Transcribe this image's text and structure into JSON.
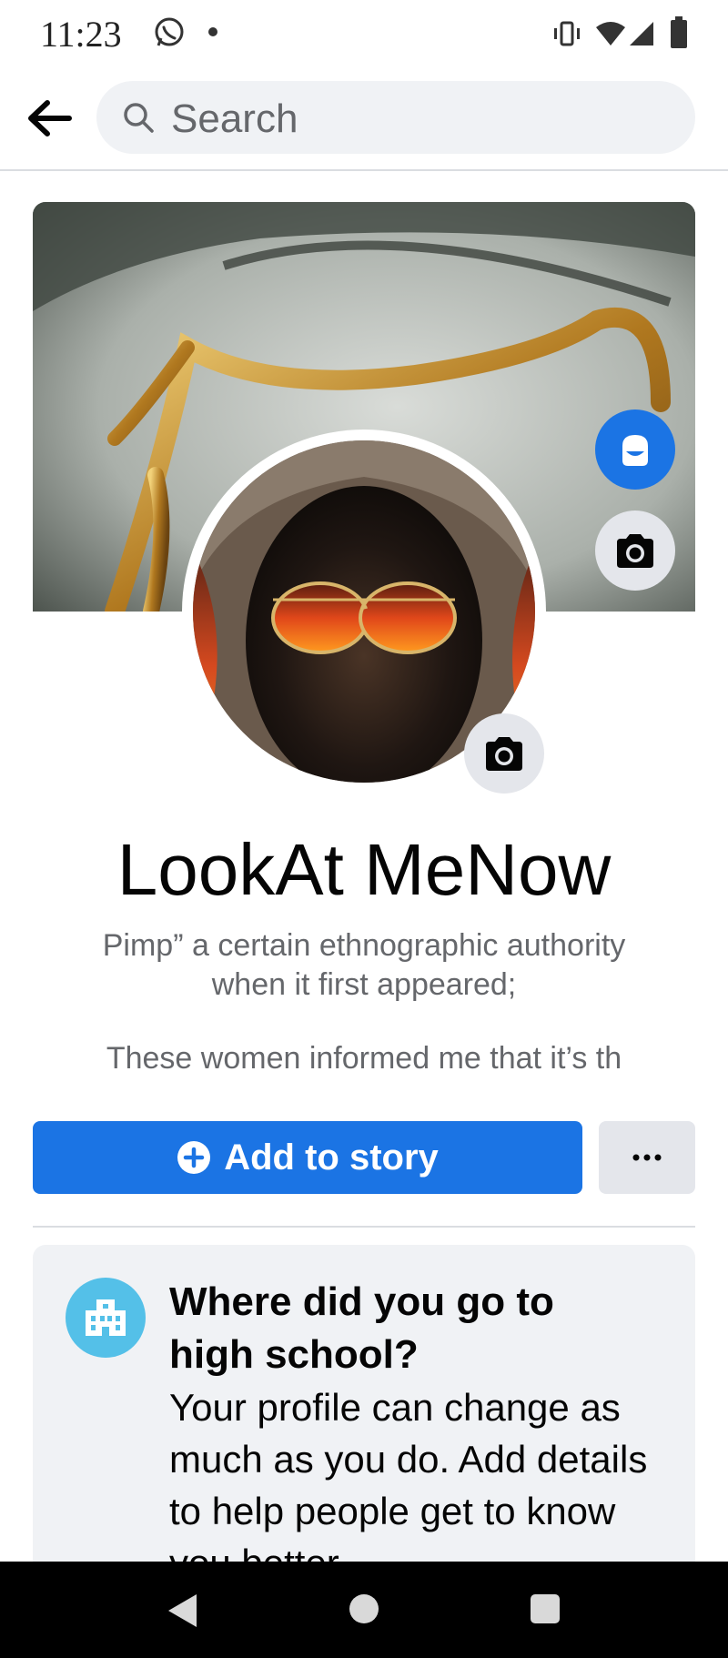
{
  "status_bar": {
    "time": "11:23",
    "icons": [
      "whatsapp-icon",
      "notification-dot",
      "vibrate-icon",
      "wifi-icon",
      "cell-signal-icon",
      "battery-icon"
    ]
  },
  "nav": {
    "back_icon": "arrow-left-icon",
    "search_placeholder": "Search"
  },
  "profile": {
    "name": "LookAt MeNow",
    "bio_line1": "Pimp” a certain ethnographic authority",
    "bio_line2": "when it first appeared;",
    "bio_line3": "These women informed me that it’s th"
  },
  "actions": {
    "add_story_label": "Add to story",
    "more_label": "···"
  },
  "high_school_card": {
    "title_line1": "Where did you go to",
    "title_line2": "high school?",
    "desc_line1": "Your profile can change as",
    "desc_line2": "much as you do. Add details",
    "desc_line3": "to help people get to know",
    "desc_line4": "you better."
  },
  "colors": {
    "accent": "#1b74e4",
    "secondary_bg": "#e4e6eb",
    "card_bg": "#f0f2f5",
    "school_icon_bg": "#54c0e8"
  }
}
